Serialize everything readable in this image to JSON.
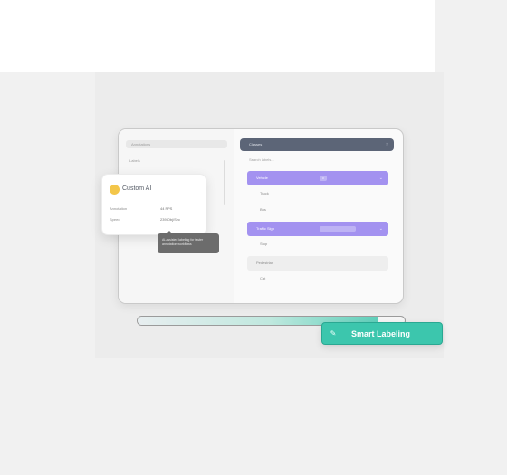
{
  "left_pane": {
    "header": "Annotations",
    "row": "Labels"
  },
  "right_pane": {
    "header": "Classes",
    "close": "×",
    "search": "Search labels...",
    "rows": [
      {
        "label": "Vehicle",
        "tag": "3",
        "chev": "⌄"
      },
      {
        "label": "Truck"
      },
      {
        "label": "Bus"
      },
      {
        "label": "Traffic Sign",
        "tag": "",
        "chev": "⌄"
      },
      {
        "label": "Stop"
      },
      {
        "label": "Pedestrian"
      },
      {
        "label": "Cat"
      }
    ]
  },
  "label_card": {
    "title": "Custom AI",
    "lines": [
      {
        "k": "Annotation",
        "v": "44 FPS"
      },
      {
        "k": "Speed",
        "v": "239 Obj/Sec"
      }
    ]
  },
  "tooltip": {
    "text": "AI-assisted labeling for faster annotation workflows"
  },
  "progress": {
    "value": 0.9
  },
  "smart_button": {
    "icon": "magic-wand-icon",
    "label": "Smart Labeling"
  },
  "colors": {
    "selected": "#a392f0",
    "accent": "#3cc6ad",
    "header_bg": "#5c6577",
    "yellow_dot": "#f3c64a"
  }
}
